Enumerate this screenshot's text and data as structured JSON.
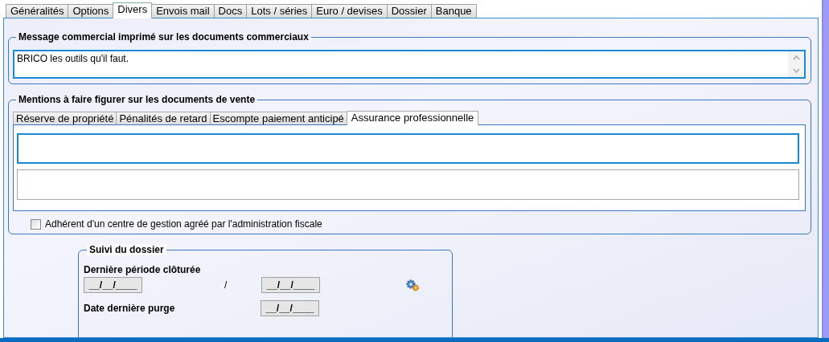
{
  "tabs": [
    {
      "label": "Généralités",
      "selected": false
    },
    {
      "label": "Options",
      "selected": false
    },
    {
      "label": "Divers",
      "selected": true
    },
    {
      "label": "Envois mail",
      "selected": false
    },
    {
      "label": "Docs",
      "selected": false
    },
    {
      "label": "Lots / séries",
      "selected": false
    },
    {
      "label": "Euro / devises",
      "selected": false
    },
    {
      "label": "Dossier",
      "selected": false
    },
    {
      "label": "Banque",
      "selected": false
    }
  ],
  "message_group": {
    "title": "Message commercial imprimé sur les documents commerciaux",
    "value": "BRICO les outils qu'il faut."
  },
  "mentions_group": {
    "title": "Mentions à faire figurer sur les documents de vente",
    "tabs": [
      {
        "label": "Réserve de propriété",
        "selected": false
      },
      {
        "label": "Pénalités de retard",
        "selected": false
      },
      {
        "label": "Escompte paiement anticipé",
        "selected": false
      },
      {
        "label": "Assurance professionnelle",
        "selected": true
      }
    ],
    "checkbox": {
      "label": "Adhérent d'un centre de gestion agréé par l'administration fiscale",
      "checked": false
    }
  },
  "suivi_group": {
    "title": "Suivi du dossier",
    "periode_label": "Dernière période clôturée",
    "periode_start": "__/__/____",
    "separator": "/",
    "periode_end": "__/__/____",
    "purge_label": "Date dernière purge",
    "purge_date": "__/__/____"
  }
}
